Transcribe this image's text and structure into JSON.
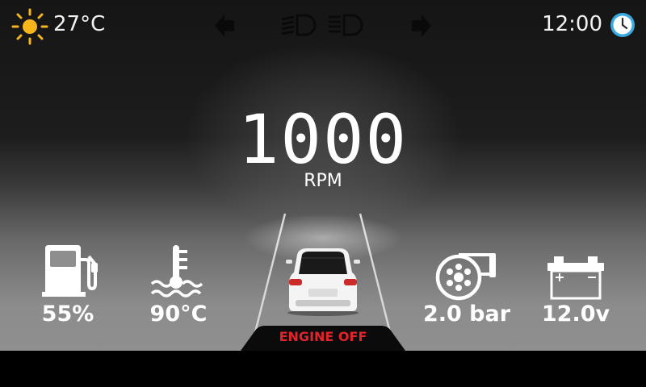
{
  "header": {
    "outside_temp": "27°C",
    "time": "12:00",
    "icons": [
      "sun-icon",
      "turn-left-icon",
      "low-beam-icon",
      "high-beam-icon",
      "turn-right-icon",
      "clock-icon"
    ]
  },
  "engine": {
    "rpm": "1000",
    "rpm_unit": "RPM",
    "status": "ENGINE OFF"
  },
  "gauges": {
    "fuel": "55%",
    "coolant": "90°C",
    "boost": "2.0 bar",
    "battery": "12.0v"
  },
  "colors": {
    "sun": "#f7b51c",
    "clock": "#39a9e0",
    "engine_status": "#e0242a"
  }
}
